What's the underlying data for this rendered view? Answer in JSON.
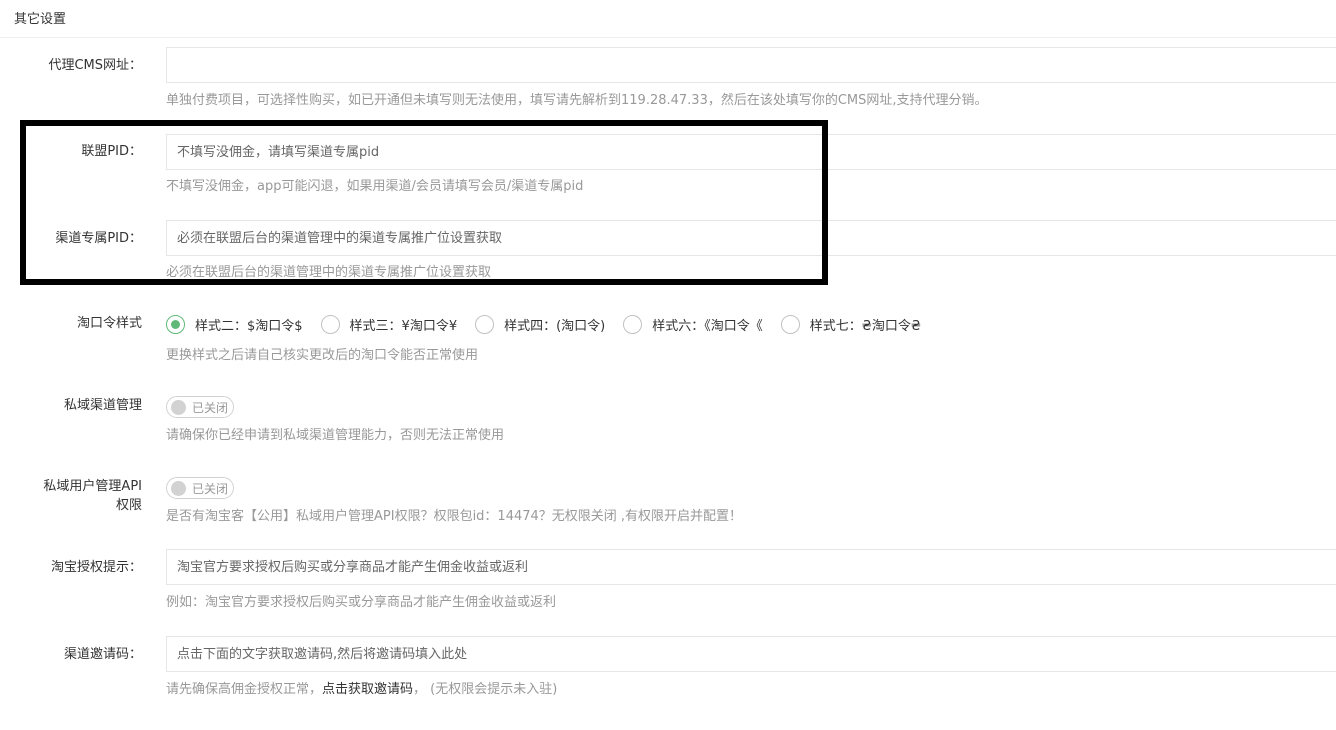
{
  "section": {
    "title": "其它设置"
  },
  "fields": {
    "agent_cms": {
      "label": "代理CMS网址：",
      "value": "",
      "placeholder": "",
      "help": "单独付费项目，可选择性购买，如已开通但未填写则无法使用，填写请先解析到119.28.47.33，然后在该处填写你的CMS网址,支持代理分销。"
    },
    "alliance_pid": {
      "label": "联盟PID：",
      "value": "",
      "placeholder": "不填写没佣金，请填写渠道专属pid",
      "help": "不填写没佣金，app可能闪退，如果用渠道/会员请填写会员/渠道专属pid"
    },
    "channel_pid": {
      "label": "渠道专属PID：",
      "value": "",
      "placeholder": "必须在联盟后台的渠道管理中的渠道专属推广位设置获取",
      "help": "必须在联盟后台的渠道管理中的渠道专属推广位设置获取"
    },
    "taokouling_style": {
      "label": "淘口令样式",
      "options": [
        {
          "label": "样式二：$淘口令$",
          "checked": true
        },
        {
          "label": "样式三：¥淘口令¥",
          "checked": false
        },
        {
          "label": "样式四：(淘口令)",
          "checked": false
        },
        {
          "label": "样式六：《淘口令《",
          "checked": false
        },
        {
          "label": "样式七：₴淘口令₴",
          "checked": false
        }
      ],
      "help": "更换样式之后请自己核实更改后的淘口令能否正常使用"
    },
    "private_channel": {
      "label": "私域渠道管理",
      "switch_text": "已关闭",
      "enabled": false,
      "help": "请确保你已经申请到私域渠道管理能力，否则无法正常使用"
    },
    "private_user_api": {
      "label_line1": "私域用户管理API",
      "label_line2": "权限",
      "switch_text": "已关闭",
      "enabled": false,
      "help": "是否有淘宝客【公用】私域用户管理API权限？权限包id：14474？无权限关闭 ,有权限开启并配置！"
    },
    "taobao_auth_tip": {
      "label": "淘宝授权提示：",
      "value": "",
      "placeholder": "淘宝官方要求授权后购买或分享商品才能产生佣金收益或返利",
      "help": "例如：淘宝官方要求授权后购买或分享商品才能产生佣金收益或返利"
    },
    "channel_invite_code": {
      "label": "渠道邀请码：",
      "value": "",
      "placeholder": "点击下面的文字获取邀请码,然后将邀请码填入此处",
      "help_prefix": "请先确保高佣金授权正常，",
      "help_link": "点击获取邀请码",
      "help_suffix": "， (无权限会提示未入驻)"
    }
  },
  "colors": {
    "accent_green": "#5FB878",
    "highlight_border": "#000000",
    "help_text": "#999999"
  }
}
